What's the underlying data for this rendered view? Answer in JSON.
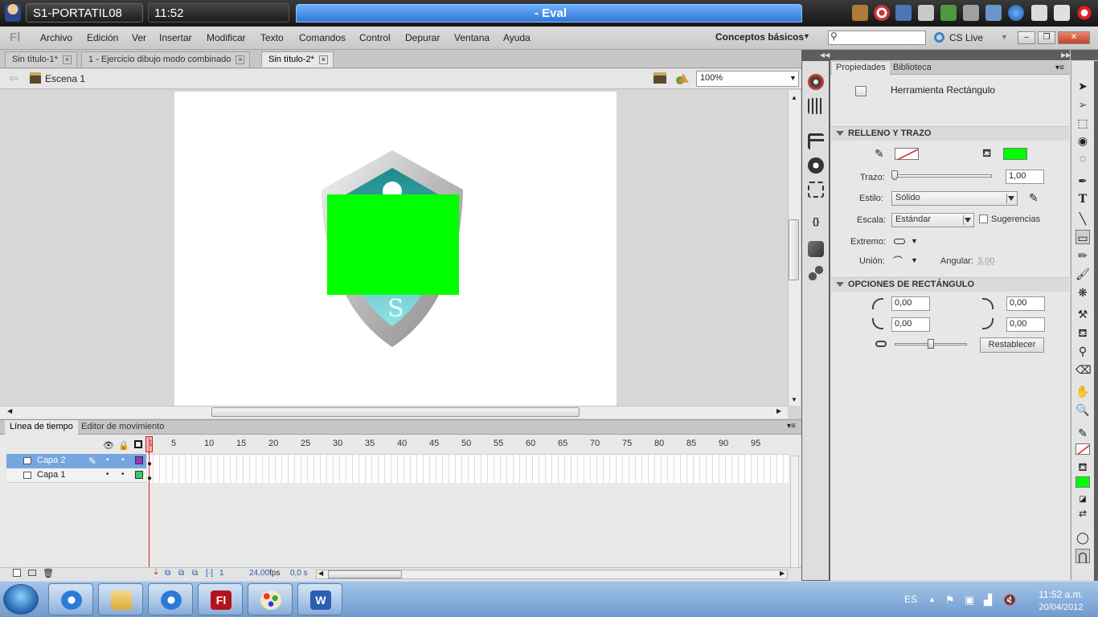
{
  "session": {
    "host": "S1-PORTATIL08",
    "time": "11:52",
    "title": "- Eval"
  },
  "app": {
    "logo": "Fl",
    "menu": [
      "Archivo",
      "Edición",
      "Ver",
      "Insertar",
      "Modificar",
      "Texto",
      "Comandos",
      "Control",
      "Depurar",
      "Ventana",
      "Ayuda"
    ],
    "workspace": "Conceptos básicos",
    "search_placeholder": "",
    "cs_live": "CS Live"
  },
  "tabs": [
    {
      "label": "Sin título-1*",
      "active": false
    },
    {
      "label": "1 - Ejercicio dibujo modo combinado",
      "active": false
    },
    {
      "label": "Sin título-2*",
      "active": true
    }
  ],
  "editbar": {
    "scene": "Escena 1",
    "zoom": "100%"
  },
  "timeline": {
    "tabs": [
      "Línea de tiempo",
      "Editor de movimiento"
    ],
    "frame_numbers": [
      "1",
      "5",
      "10",
      "15",
      "20",
      "25",
      "30",
      "35",
      "40",
      "45",
      "50",
      "55",
      "60",
      "65",
      "70",
      "75",
      "80",
      "85",
      "90",
      "95"
    ],
    "layers": [
      {
        "name": "Capa 2",
        "selected": true,
        "color": "#9933cc"
      },
      {
        "name": "Capa 1",
        "selected": false,
        "color": "#33cc66"
      }
    ],
    "footer": {
      "current_frame": "1",
      "fps": "24,00",
      "fps_unit": "fps",
      "time": "0,0 s"
    }
  },
  "properties": {
    "tabs": [
      "Propiedades",
      "Biblioteca"
    ],
    "tool_name": "Herramienta Rectángulo",
    "sections": {
      "fill_stroke": "RELLENO Y TRAZO",
      "rect_options": "OPCIONES DE RECTÁNGULO"
    },
    "fill_color": "#00ff00",
    "stroke_label": "Trazo:",
    "stroke_value": "1,00",
    "style_label": "Estilo:",
    "style_value": "Sólido",
    "scale_label": "Escala:",
    "scale_value": "Estándar",
    "hints_label": "Sugerencias",
    "cap_label": "Extremo:",
    "join_label": "Unión:",
    "miter_label": "Angular:",
    "miter_value": "3,00",
    "corners": [
      "0,00",
      "0,00",
      "0,00",
      "0,00"
    ],
    "reset_label": "Restablecer"
  },
  "taskbar": {
    "lang": "ES",
    "clock_time": "11:52 a.m.",
    "clock_date": "20/04/2012"
  },
  "colors": {
    "stage_rect": "#00ff00",
    "accent": "#2f77d6"
  }
}
